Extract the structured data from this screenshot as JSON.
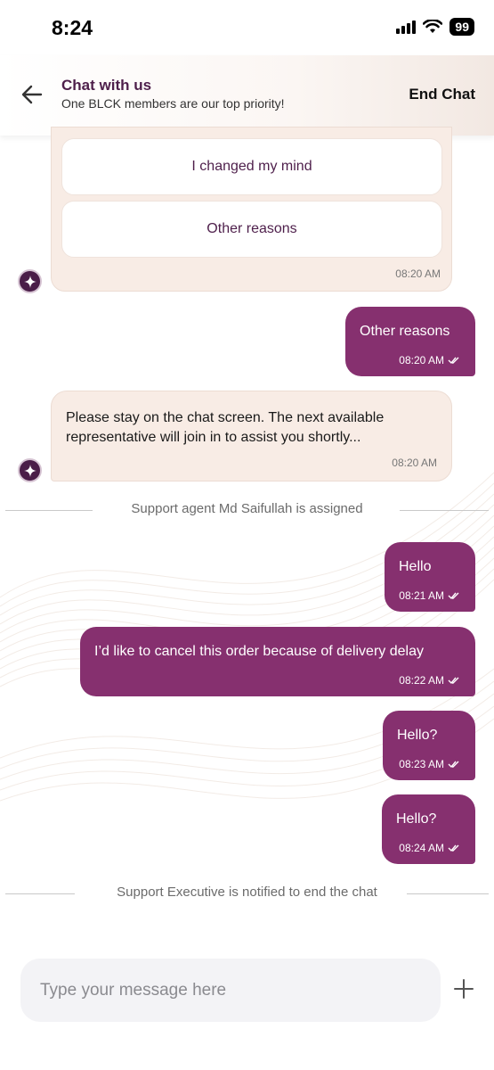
{
  "status_bar": {
    "time": "8:24",
    "battery": "99"
  },
  "header": {
    "title": "Chat with us",
    "subtitle": "One BLCK members are our top priority!",
    "end_chat": "End Chat"
  },
  "bot_options": {
    "items": [
      "I changed my mind",
      "Other reasons"
    ],
    "time": "08:20 AM"
  },
  "messages": [
    {
      "text": "Other reasons",
      "time": "08:20 AM"
    },
    {
      "text": "Please stay on the chat screen. The next available representative will join in to assist you shortly...",
      "time": "08:20 AM"
    },
    {
      "text": "Support agent Md Saifullah is assigned"
    },
    {
      "text": "Hello",
      "time": "08:21 AM"
    },
    {
      "text": "I’d like to cancel this order because of delivery delay",
      "time": "08:22 AM"
    },
    {
      "text": "Hello?",
      "time": "08:23 AM"
    },
    {
      "text": "Hello?",
      "time": "08:24 AM"
    },
    {
      "text": "Support Executive is notified to end the chat"
    }
  ],
  "composer": {
    "placeholder": "Type your message here"
  },
  "colors": {
    "accent": "#86306f",
    "brand_dark": "#4e1f4b",
    "bot_bubble": "#f8ece5"
  },
  "icons": [
    "back-arrow-icon",
    "double-check-icon",
    "sparkle-icon",
    "plus-icon",
    "wifi-icon",
    "signal-icon"
  ]
}
